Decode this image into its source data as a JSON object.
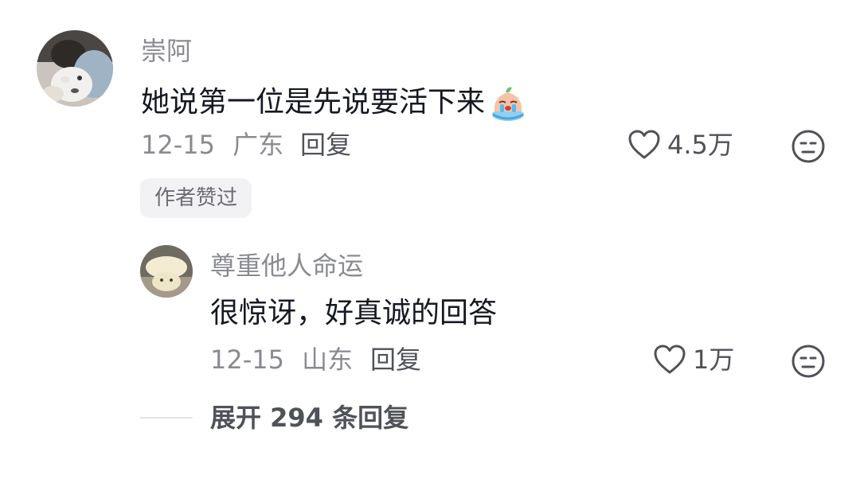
{
  "comment": {
    "username": "崇阿",
    "text": "她说第一位是先说要活下来",
    "date": "12-15",
    "location": "广东",
    "reply_label": "回复",
    "like_count": "4.5万",
    "author_liked_badge": "作者赞过",
    "emoji": "crying-emoji"
  },
  "reply": {
    "username": "尊重他人命运",
    "text": "很惊讶，好真诚的回答",
    "date": "12-15",
    "location": "山东",
    "reply_label": "回复",
    "like_count": "1万"
  },
  "expand": {
    "label": "展开 294 条回复"
  },
  "colors": {
    "primary_text": "#161823",
    "secondary_text": "#8a8b91",
    "action_text": "#505259",
    "badge_bg": "#f2f2f4"
  }
}
